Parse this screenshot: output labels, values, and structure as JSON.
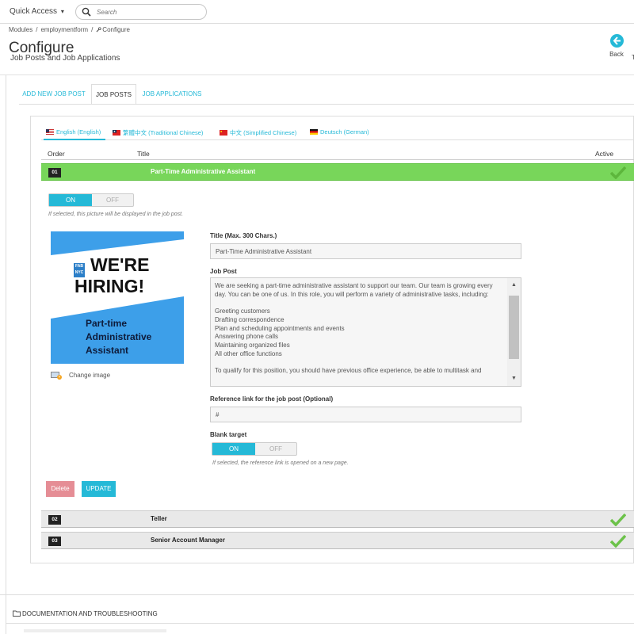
{
  "topbar": {
    "quick_access_label": "Quick Access",
    "quick_access_caret": "▾",
    "search_placeholder": "Search"
  },
  "header": {
    "breadcrumb": [
      "Modules",
      "employmentform",
      "Configure"
    ],
    "breadcrumb_sep": "/",
    "title": "Configure",
    "subtitle": "Job Posts and Job Applications",
    "back_label": "Back",
    "edge_label": "T"
  },
  "tabs": [
    {
      "label": "ADD NEW JOB POST",
      "active": false
    },
    {
      "label": "JOB POSTS",
      "active": true
    },
    {
      "label": "JOB APPLICATIONS",
      "active": false
    }
  ],
  "languages": [
    {
      "label": "English (English)",
      "flag": "us-flag"
    },
    {
      "label": "繁體中文 (Traditional Chinese)",
      "flag": "tw-flag"
    },
    {
      "label": "中文 (Simplified Chinese)",
      "flag": "cn-flag"
    },
    {
      "label": "Deutsch (German)",
      "flag": "de-flag"
    }
  ],
  "table": {
    "col_order": "Order",
    "col_title": "Title",
    "col_active": "Active",
    "rows": [
      {
        "order": "01",
        "title": "Part-Time Administrative Assistant",
        "active": true
      },
      {
        "order": "02",
        "title": "Teller",
        "active": true
      },
      {
        "order": "03",
        "title": "Senior Account Manager",
        "active": true
      }
    ]
  },
  "image_toggle": {
    "on": "ON",
    "off": "OFF",
    "hint": "If selected, this picture will be displayed in the job post."
  },
  "hiring_image": {
    "badge_line1": "FAB",
    "badge_line2": "NYC",
    "headline1": "WE'RE",
    "headline2": "HIRING!",
    "sub1": "Part-time",
    "sub2": "Administrative",
    "sub3": "Assistant",
    "change_label": "Change image"
  },
  "form": {
    "title_label": "Title (Max. 300 Chars.)",
    "title_value": "Part-Time Administrative Assistant",
    "post_label": "Job Post",
    "post_text": "We are seeking a part-time administrative assistant to support our team. Our team is growing every day. You can be one of us. In this role, you will perform a variety of administrative tasks, including:\n\nGreeting customers\nDrafting correspondence\nPlan and scheduling appointments and events\nAnswering phone calls\nMaintaining organized files\nAll other office functions\n\nTo qualify for this position, you should have previous office experience, be able to multitask and",
    "scroll_up": "▲",
    "scroll_down": "▼",
    "ref_label": "Reference link for the job post (Optional)",
    "ref_value": "#",
    "blank_label": "Blank target",
    "blank_on": "ON",
    "blank_off": "OFF",
    "blank_hint": "If selected, the reference link is opened on a new page."
  },
  "buttons": {
    "delete": "Delete",
    "update": "UPDATE"
  },
  "docs": {
    "title": "DOCUMENTATION AND TROUBLESHOOTING"
  },
  "colors": {
    "accent": "#25b9d7",
    "active_row": "#78d65a",
    "check": "#6cc24a",
    "delete": "#e58d95",
    "hiring_blue": "#3d9fe9"
  }
}
